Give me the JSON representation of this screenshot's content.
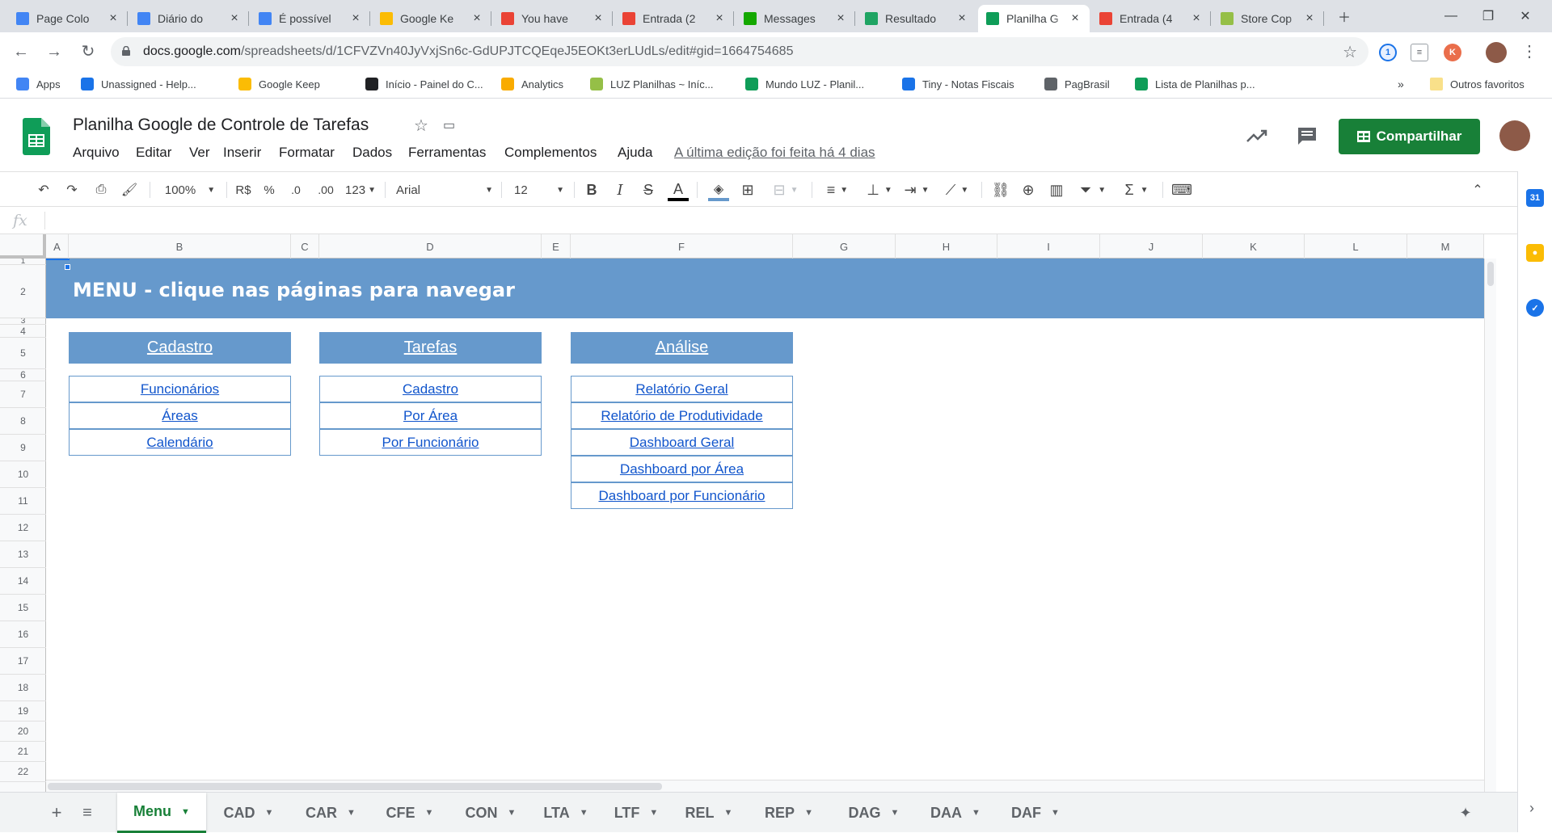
{
  "browser": {
    "tabs": [
      {
        "title": "Page Colo",
        "icon": "docs-icon",
        "color": "#4285f4"
      },
      {
        "title": "Diário do",
        "icon": "docs-icon",
        "color": "#4285f4"
      },
      {
        "title": "É possível",
        "icon": "docs-icon",
        "color": "#4285f4"
      },
      {
        "title": "Google Ke",
        "icon": "keep-icon",
        "color": "#fbbc04"
      },
      {
        "title": "You have",
        "icon": "gmail-icon",
        "color": "#ea4335"
      },
      {
        "title": "Entrada (2",
        "icon": "gmail-icon",
        "color": "#ea4335"
      },
      {
        "title": "Messages",
        "icon": "upwork-icon",
        "color": "#14a800"
      },
      {
        "title": "Resultado",
        "icon": "drive-icon",
        "color": "#1fa463"
      },
      {
        "title": "Planilha G",
        "icon": "sheets-icon",
        "color": "#0f9d58"
      },
      {
        "title": "Entrada (4",
        "icon": "gmail-icon",
        "color": "#ea4335"
      },
      {
        "title": "Store Cop",
        "icon": "shopify-icon",
        "color": "#95bf47"
      }
    ],
    "active_tab": 8,
    "url_host": "docs.google.com",
    "url_path": "/spreadsheets/d/1CFVZVn40JyVxjSn6c-GdUPJTCQEqeJ5EOKt3erLUdLs/edit#gid=1664754685",
    "bookmarks": [
      {
        "label": "Apps",
        "icon": "apps-grid-icon",
        "color": "#4285f4"
      },
      {
        "label": "Unassigned - Help...",
        "icon": "helpdesk-icon",
        "color": "#1a73e8"
      },
      {
        "label": "Google Keep",
        "icon": "keep-icon",
        "color": "#fbbc04"
      },
      {
        "label": "Início - Painel do C...",
        "icon": "panel-icon",
        "color": "#202124"
      },
      {
        "label": "Analytics",
        "icon": "analytics-icon",
        "color": "#f9ab00"
      },
      {
        "label": "LUZ Planilhas ~ Iníc...",
        "icon": "shopify-icon",
        "color": "#95bf47"
      },
      {
        "label": "Mundo LUZ - Planil...",
        "icon": "sheets-plus-icon",
        "color": "#0f9d58"
      },
      {
        "label": "Tiny - Notas Fiscais",
        "icon": "tiny-icon",
        "color": "#1a73e8"
      },
      {
        "label": "PagBrasil",
        "icon": "pagbrasil-icon",
        "color": "#5f6368"
      },
      {
        "label": "Lista de Planilhas p...",
        "icon": "sheets-plus-icon",
        "color": "#0f9d58"
      }
    ],
    "bookmarks_overflow": "»",
    "other_bookmarks": "Outros favoritos"
  },
  "doc": {
    "title": "Planilha Google de Controle de Tarefas",
    "menus": [
      "Arquivo",
      "Editar",
      "Ver",
      "Inserir",
      "Formatar",
      "Dados",
      "Ferramentas",
      "Complementos",
      "Ajuda"
    ],
    "last_edit": "A última edição foi feita há 4 dias",
    "share_label": "Compartilhar"
  },
  "toolbar": {
    "zoom": "100%",
    "currency": "R$",
    "percent": "%",
    "dec_less": ".0",
    "dec_more": ".00",
    "more_formats": "123",
    "font": "Arial",
    "font_size": "12"
  },
  "formula_bar": {
    "fx": "fx",
    "value": ""
  },
  "columns": [
    "A",
    "B",
    "C",
    "D",
    "E",
    "F",
    "G",
    "H",
    "I",
    "J",
    "K",
    "L",
    "M"
  ],
  "rows": [
    "1",
    "2",
    "3",
    "4",
    "5",
    "6",
    "7",
    "8",
    "9",
    "10",
    "11",
    "12",
    "13",
    "14",
    "15",
    "16",
    "17",
    "18",
    "19",
    "20",
    "21",
    "22"
  ],
  "sheet": {
    "banner": "MENU - clique nas páginas para navegar",
    "sections": [
      {
        "header": "Cadastro",
        "links": [
          "Funcionários",
          "Áreas",
          "Calendário"
        ]
      },
      {
        "header": "Tarefas",
        "links": [
          "Cadastro",
          "Por Área",
          "Por Funcionário"
        ]
      },
      {
        "header": "Análise",
        "links": [
          "Relatório Geral",
          "Relatório de Produtividade",
          "Dashboard Geral",
          "Dashboard por Área",
          "Dashboard por Funcionário"
        ]
      }
    ]
  },
  "sheet_tabs": [
    "Menu",
    "CAD",
    "CAR",
    "CFE",
    "CON",
    "LTA",
    "LTF",
    "REL",
    "REP",
    "DAG",
    "DAA",
    "DAF"
  ],
  "active_sheet": "Menu",
  "colors": {
    "header_blue": "#6699cc",
    "link_blue": "#1155cc",
    "share_green": "#188038"
  }
}
